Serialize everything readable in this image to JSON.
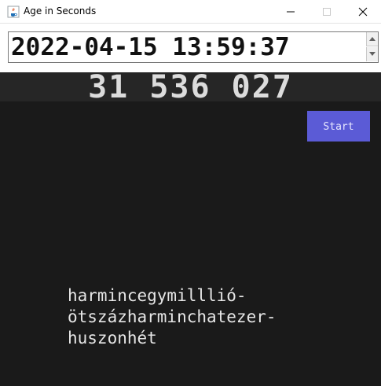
{
  "window": {
    "title": "Age in Seconds",
    "icons": {
      "app": "java-cup-icon",
      "minimize": "minimize-icon",
      "maximize": "maximize-icon",
      "close": "close-icon"
    }
  },
  "date_spinner": {
    "value": "2022-04-15 13:59:37",
    "icons": {
      "up": "arrow-up-icon",
      "down": "arrow-down-icon"
    }
  },
  "seconds_display": "31 536 027",
  "start_button": {
    "label": "Start"
  },
  "words": {
    "lines": [
      "harmincegymilllió-",
      "ötszázharminchatezer-",
      "huszonhét"
    ]
  },
  "colors": {
    "background": "#1a1a1a",
    "band": "#262626",
    "accent": "#5b5bd6",
    "text": "#e6e6e6"
  }
}
